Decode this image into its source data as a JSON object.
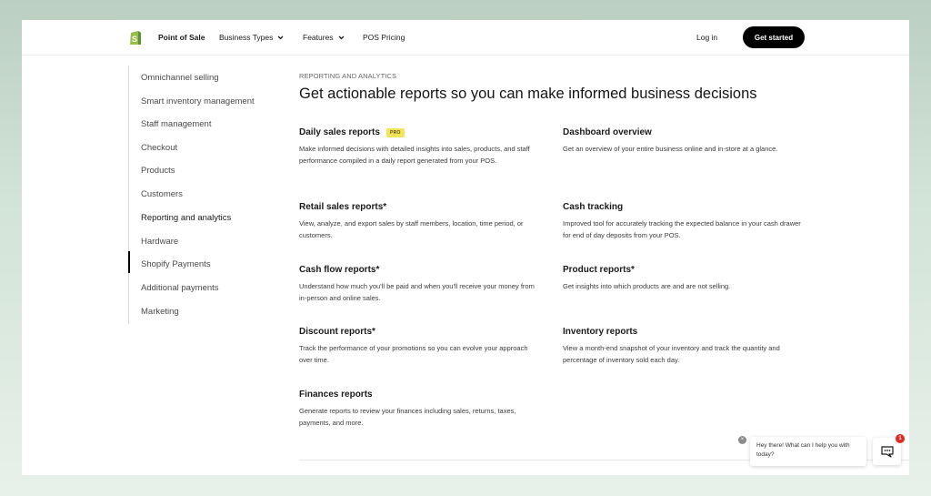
{
  "header": {
    "brand": "Point of Sale",
    "nav": [
      {
        "label": "Business Types",
        "has_dropdown": true
      },
      {
        "label": "Features",
        "has_dropdown": true
      },
      {
        "label": "POS Pricing",
        "has_dropdown": false
      }
    ],
    "login_label": "Log in",
    "cta_label": "Get started"
  },
  "sidebar": {
    "active_index": 6,
    "items": [
      {
        "label": "Omnichannel selling"
      },
      {
        "label": "Smart inventory management"
      },
      {
        "label": "Staff management"
      },
      {
        "label": "Checkout"
      },
      {
        "label": "Products"
      },
      {
        "label": "Customers"
      },
      {
        "label": "Reporting and analytics"
      },
      {
        "label": "Hardware"
      },
      {
        "label": "Shopify Payments"
      },
      {
        "label": "Additional payments"
      },
      {
        "label": "Marketing"
      }
    ]
  },
  "main": {
    "eyebrow": "REPORTING AND ANALYTICS",
    "title": "Get actionable reports so you can make informed business decisions",
    "features": [
      {
        "title": "Daily sales reports",
        "badge": "PRO",
        "description": "Make informed decisions with detailed insights into sales, products, and staff performance compiled in a daily report generated from your POS."
      },
      {
        "title": "Dashboard overview",
        "description": "Get an overview of your entire business online and in-store at a glance."
      },
      {
        "title": "Retail sales reports*",
        "description": "View, analyze, and export sales by staff members, location, time period, or customers."
      },
      {
        "title": "Cash tracking",
        "description": "Improved tool for accurately tracking the expected balance in your cash drawer for end of day deposits from your POS."
      },
      {
        "title": "Cash flow reports*",
        "description": "Understand how much you'll be paid and when you'll receive your money from in-person and online sales."
      },
      {
        "title": "Product reports*",
        "description": "Get insights into which products are and are not selling."
      },
      {
        "title": "Discount reports*",
        "description": "Track the performance of your promotions so you can evolve your approach over time."
      },
      {
        "title": "Inventory reports",
        "description": "View a month-end snapshot of your inventory and track the quantity and percentage of inventory sold each day."
      },
      {
        "title": "Finances reports",
        "description": "Generate reports to review your finances including sales, returns, taxes, payments, and more."
      }
    ]
  },
  "chat": {
    "message": "Hey there! What can I help you with today?",
    "unread_count": "1",
    "close_glyph": "×"
  },
  "colors": {
    "brand_green": "#95bf47",
    "pro_badge": "#f3e55b",
    "notification": "#e0281e",
    "cta_bg": "#000000"
  }
}
